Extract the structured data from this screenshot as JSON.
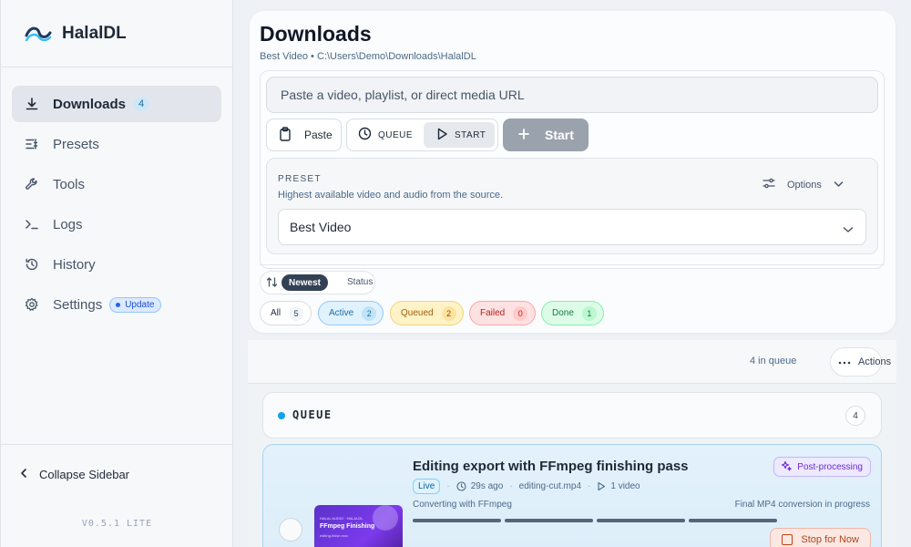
{
  "app": {
    "name": "HalalDL",
    "version": "V0.5.1 LITE"
  },
  "sidebar": {
    "items": [
      {
        "label": "Downloads",
        "badge": "4",
        "icon": "download-icon",
        "active": true
      },
      {
        "label": "Presets",
        "icon": "presets-icon"
      },
      {
        "label": "Tools",
        "icon": "wrench-icon"
      },
      {
        "label": "Logs",
        "icon": "terminal-icon"
      },
      {
        "label": "History",
        "icon": "history-icon"
      },
      {
        "label": "Settings",
        "icon": "gear-icon",
        "badge": "Update"
      }
    ],
    "collapse_label": "Collapse Sidebar"
  },
  "header": {
    "title": "Downloads",
    "subtitle": "Best Video • C:\\Users\\Demo\\Downloads\\HalalDL"
  },
  "input": {
    "placeholder": "Paste a video, playlist, or direct media URL",
    "paste_label": "Paste",
    "queue_label": "QUEUE",
    "start_mode_label": "START",
    "start_label": "Start"
  },
  "preset": {
    "label": "PRESET",
    "description": "Highest available video and audio from the source.",
    "options_label": "Options",
    "selected": "Best Video"
  },
  "sort": {
    "newest": "Newest",
    "status": "Status"
  },
  "filters": [
    {
      "label": "All",
      "count": "5"
    },
    {
      "label": "Active",
      "count": "2"
    },
    {
      "label": "Queued",
      "count": "2"
    },
    {
      "label": "Failed",
      "count": "0"
    },
    {
      "label": "Done",
      "count": "1"
    }
  ],
  "queue": {
    "in_queue": "4 in queue",
    "actions_label": "Actions",
    "section_title": "QUEUE",
    "section_count": "4"
  },
  "job": {
    "title": "Editing export with FFmpeg finishing pass",
    "live": "Live",
    "time": "29s ago",
    "file": "editing-cut.mp4",
    "videos": "1 video",
    "badge": "Post-processing",
    "status_left": "Converting with FFmpeg",
    "status_right": "Final MP4 conversion in progress",
    "stop_label": "Stop for Now",
    "thumb_small": "HALAL AUDIO · HALALDL",
    "thumb_title": "FFmpeg Finishing",
    "thumb_sub": "editing-finish.mov"
  },
  "colors": {
    "accent": "#0ea5e9",
    "sidebar_active": "#e2e6ec",
    "start_disabled": "#9aa2ad",
    "post_processing": "#6d28d9",
    "stop": "#b4431f"
  }
}
